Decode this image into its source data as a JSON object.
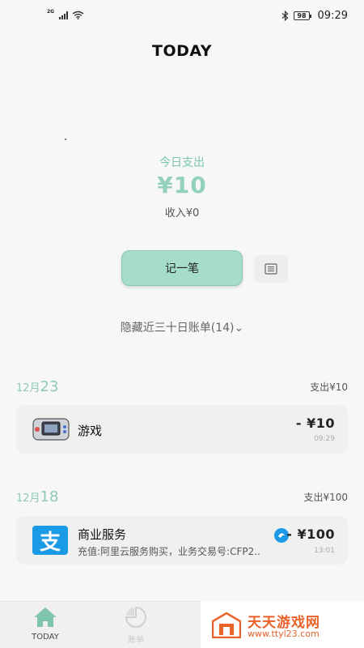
{
  "status_bar": {
    "network": "2G",
    "battery": "98",
    "time": "09:29"
  },
  "header": {
    "title": "TODAY"
  },
  "summary": {
    "expense_label": "今日支出",
    "expense_amount": "¥10",
    "income": "收入¥0"
  },
  "actions": {
    "record_label": "记一笔"
  },
  "history_toggle": {
    "label": "隐藏近三十日账单(14)",
    "chevron": "⌄"
  },
  "groups": [
    {
      "month": "12月",
      "day": "23",
      "total": "支出¥10",
      "items": [
        {
          "icon": "game-controller-icon",
          "name": "游戏",
          "amount": "- ¥10",
          "time": "09:29"
        }
      ]
    },
    {
      "month": "12月",
      "day": "18",
      "total": "支出¥100",
      "items": [
        {
          "icon": "alipay-icon",
          "icon_glyph": "支",
          "name": "商业服务",
          "amount": "- ¥100",
          "desc": "充值:阿里云服务购买，业务交易号:CFP2..",
          "time": "13:01"
        }
      ]
    }
  ],
  "tab_bar": {
    "tabs": [
      {
        "label": "TODAY",
        "active": true
      },
      {
        "label": "账单",
        "active": false
      }
    ]
  },
  "watermark": {
    "title": "天天游戏网",
    "url": "www.ttyl23.com"
  },
  "colors": {
    "accent": "#94d1bb",
    "button": "#a6dccb",
    "watermark": "#e8622a",
    "alipay": "#1b9ae5"
  }
}
